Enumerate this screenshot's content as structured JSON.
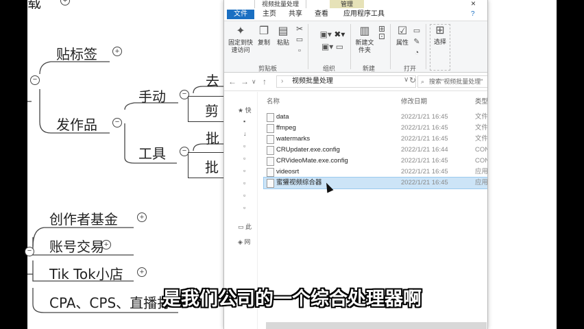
{
  "mindmap": {
    "top_cut": "载",
    "tie_biaoqian": "贴标签",
    "fa_zuopin": "发作品",
    "shoudong": "手动",
    "gongju": "工具",
    "qu_cut": "去",
    "jian_cut": "剪",
    "pi_cut_1": "批",
    "pi_cut_2": "批",
    "chuangzuozhe": "创作者基金",
    "zhanghao": "账号交易",
    "tiktok": "Tik Tok小店",
    "cpa": "CPA、CPS、直播打"
  },
  "explorer": {
    "title_tab": "视频批量处理",
    "manage_tab": "管理",
    "ribbon_tabs": {
      "file": "文件",
      "home": "主页",
      "share": "共享",
      "view": "查看",
      "app_tools": "应用程序工具"
    },
    "ribbon": {
      "pin": "固定到快速访问",
      "copy": "复制",
      "paste": "粘贴",
      "new_folder": "新建文件夹",
      "properties": "属性",
      "select": "选择",
      "group_clipboard": "剪贴板",
      "group_organize": "组织",
      "group_new": "新建",
      "group_open": "打开"
    },
    "path": "视频批量处理",
    "search_placeholder": "搜索\"视频批量处理\"",
    "columns": {
      "name": "名称",
      "date": "修改日期",
      "type": "类型"
    },
    "nav": {
      "quick": "快",
      "pc": "此",
      "net": "网"
    },
    "files": [
      {
        "name": "data",
        "date": "2022/1/21 16:45",
        "type": "文件"
      },
      {
        "name": "ffmpeg",
        "date": "2022/1/21 16:45",
        "type": "文件"
      },
      {
        "name": "watermarks",
        "date": "2022/1/21 16:45",
        "type": "文件"
      },
      {
        "name": "CRUpdater.exe.config",
        "date": "2022/1/21 16:44",
        "type": "CON"
      },
      {
        "name": "CRVideoMate.exe.config",
        "date": "2022/1/21 16:45",
        "type": "CON"
      },
      {
        "name": "videosrt",
        "date": "2022/1/21 16:45",
        "type": "应用"
      },
      {
        "name": "蜜獾视频综合器",
        "date": "2022/1/21 16:45",
        "type": "应用"
      }
    ]
  },
  "subtitle": "是我们公司的一个综合处理器啊"
}
